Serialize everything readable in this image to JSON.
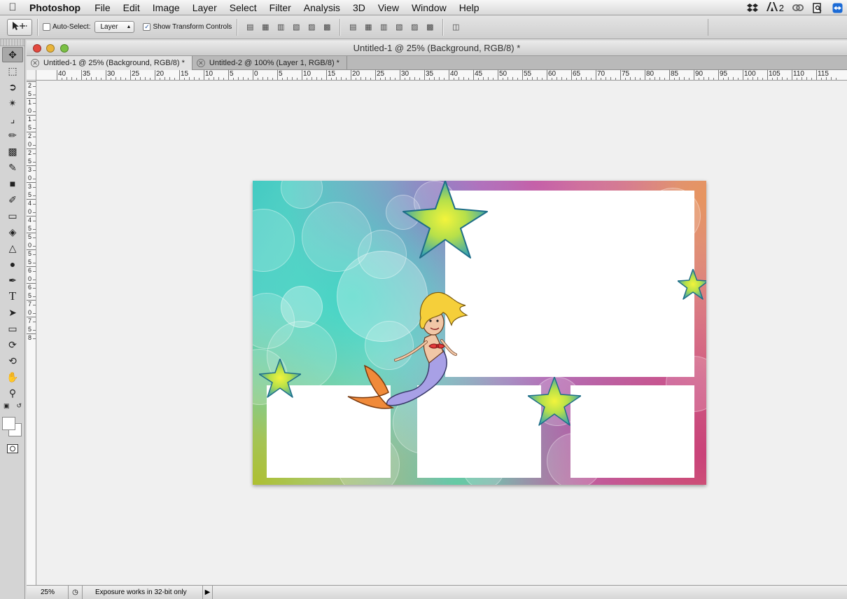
{
  "menubar": {
    "app": "Photoshop",
    "items": [
      "File",
      "Edit",
      "Image",
      "Layer",
      "Select",
      "Filter",
      "Analysis",
      "3D",
      "View",
      "Window",
      "Help"
    ],
    "tray_adobe": "2"
  },
  "options": {
    "auto_select_label": "Auto-Select:",
    "auto_select_checked": false,
    "auto_select_target": "Layer",
    "transform_label": "Show Transform Controls",
    "transform_checked": true
  },
  "document": {
    "window_title": "Untitled-1 @ 25% (Background, RGB/8) *",
    "tabs": [
      {
        "label": "Untitled-1 @ 25% (Background, RGB/8) *",
        "active": true
      },
      {
        "label": "Untitled-2 @ 100% (Layer 1, RGB/8) *",
        "active": false
      }
    ]
  },
  "ruler": {
    "h_labels": [
      "40",
      "35",
      "30",
      "25",
      "20",
      "15",
      "10",
      "5",
      "0",
      "5",
      "10",
      "15",
      "20",
      "25",
      "30",
      "35",
      "40",
      "45",
      "50",
      "55",
      "60",
      "65",
      "70",
      "75",
      "80",
      "85",
      "90",
      "95",
      "100",
      "105",
      "110",
      "115"
    ],
    "v_labels": [
      "2",
      "5",
      "1",
      "0",
      "1",
      "5",
      "2",
      "0",
      "2",
      "5",
      "3",
      "0",
      "3",
      "5",
      "4",
      "0",
      "4",
      "5",
      "5",
      "0",
      "5",
      "5",
      "6",
      "0",
      "6",
      "5",
      "7",
      "0",
      "7",
      "5",
      "8"
    ]
  },
  "status": {
    "zoom": "25%",
    "message": "Exposure works in 32-bit only"
  },
  "colors": {
    "foreground": "#ffffff",
    "background": "#ffffff"
  }
}
